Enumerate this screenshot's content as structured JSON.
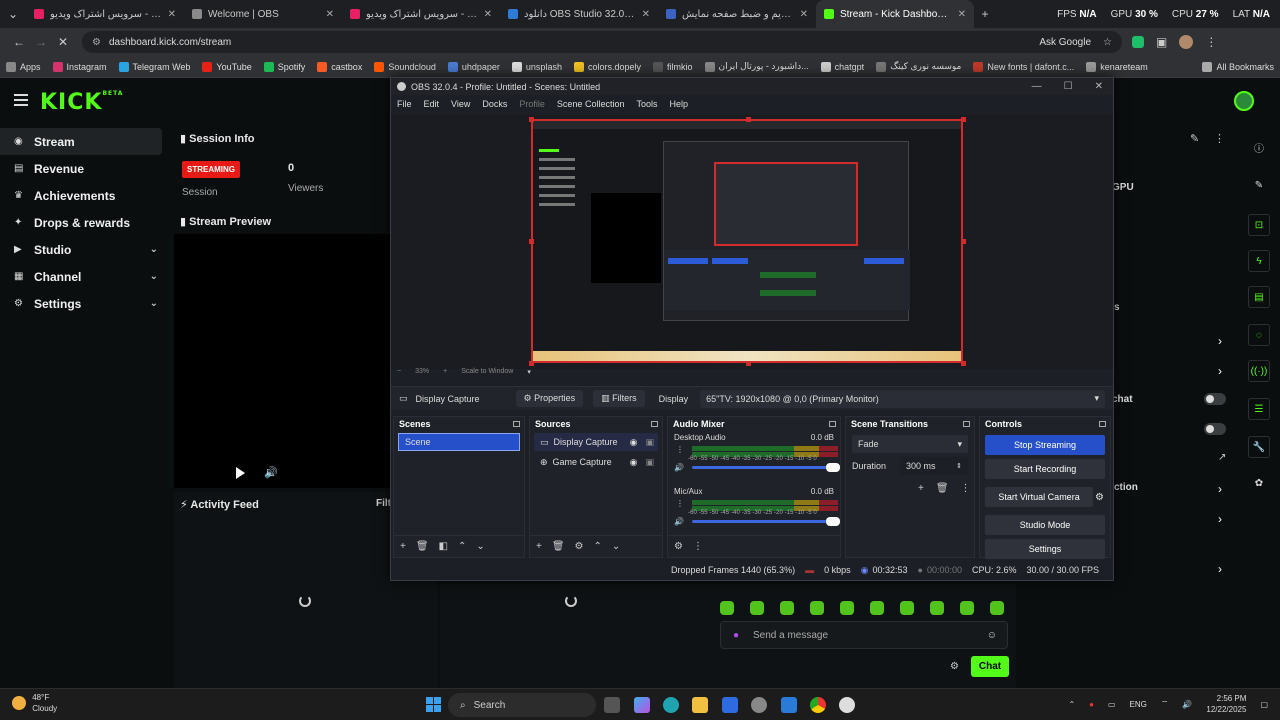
{
  "browser": {
    "tabs": [
      {
        "title": "آپارات - سرویس اشتراک ویدیو",
        "color": "#e91e63",
        "active": false
      },
      {
        "title": "Welcome | OBS",
        "color": "#8a8a8a",
        "active": false
      },
      {
        "title": "آپارات - سرویس اشتراک ویدیو",
        "color": "#e91e63",
        "active": false
      },
      {
        "title": "دانلود OBS Studio 32.0.4 Win/Mac",
        "color": "#2e7bd6",
        "active": false
      },
      {
        "title": "آموزش استریم و ضبط صفحه نمایش",
        "color": "#3b63c4",
        "active": false
      },
      {
        "title": "Stream - Kick Dashboard",
        "color": "#53fc18",
        "active": true
      }
    ],
    "new_tab": "+",
    "perf": {
      "fps_label": "FPS",
      "fps": "N/A",
      "gpu_label": "GPU",
      "gpu": "30 %",
      "cpu_label": "CPU",
      "cpu": "27 %",
      "lat_label": "LAT",
      "lat": "N/A"
    },
    "url": "dashboard.kick.com/stream",
    "ask_google": "Ask Google",
    "bookmarks": [
      {
        "label": "Apps",
        "color": "#888"
      },
      {
        "label": "Instagram",
        "color": "#d6336c"
      },
      {
        "label": "Telegram Web",
        "color": "#2aa3e3"
      },
      {
        "label": "YouTube",
        "color": "#e62117"
      },
      {
        "label": "Spotify",
        "color": "#1db954"
      },
      {
        "label": "castbox",
        "color": "#f55b23"
      },
      {
        "label": "Soundcloud",
        "color": "#ff5500"
      },
      {
        "label": "uhdpaper",
        "color": "#4a7bd0"
      },
      {
        "label": "unsplash",
        "color": "#ddd"
      },
      {
        "label": "colors.dopely",
        "color": "#f0c020"
      },
      {
        "label": "filmkio",
        "color": "#555"
      },
      {
        "label": "داشبورد - پورتال ایران...",
        "color": "#888"
      },
      {
        "label": "chatgpt",
        "color": "#ccc"
      },
      {
        "label": "موسسه نوری کینگ",
        "color": "#777"
      },
      {
        "label": "New fonts | dafont.c...",
        "color": "#c0392b"
      },
      {
        "label": "kenareteam",
        "color": "#999"
      }
    ],
    "all_bookmarks": "All Bookmarks"
  },
  "kick": {
    "logo": "KICK",
    "beta": "BETA",
    "nav": [
      {
        "label": "Stream",
        "icon": "radio-icon",
        "active": true,
        "chevron": false
      },
      {
        "label": "Revenue",
        "icon": "revenue-icon",
        "active": false,
        "chevron": false
      },
      {
        "label": "Achievements",
        "icon": "trophy-icon",
        "active": false,
        "chevron": false
      },
      {
        "label": "Drops & rewards",
        "icon": "gift-icon",
        "active": false,
        "chevron": false
      },
      {
        "label": "Studio",
        "icon": "studio-icon",
        "active": false,
        "chevron": true
      },
      {
        "label": "Channel",
        "icon": "channel-icon",
        "active": false,
        "chevron": true
      },
      {
        "label": "Settings",
        "icon": "gear-icon",
        "active": false,
        "chevron": true
      }
    ],
    "session_info": "Session Info",
    "status_badge": "STREAMING",
    "session_label": "Session",
    "viewers_count": "0",
    "viewers_label": "Viewers",
    "stream_preview": "Stream Preview",
    "activity_feed": "Activity Feed",
    "filter": "Filt",
    "right_labels": [
      "GPU",
      "s",
      "chat",
      "ction"
    ],
    "send_placeholder": "Send a message",
    "chat_button": "Chat",
    "accent": "#53fc18"
  },
  "obs": {
    "title": "OBS 32.0.4 - Profile: Untitled - Scenes: Untitled",
    "menu": [
      "File",
      "Edit",
      "View",
      "Docks",
      "Profile",
      "Scene Collection",
      "Tools",
      "Help"
    ],
    "zoom": "33%",
    "scale": "Scale to Window",
    "source_name": "Display Capture",
    "properties": "Properties",
    "filters": "Filters",
    "display_label": "Display",
    "display_value": "65\"TV: 1920x1080 @ 0,0 (Primary Monitor)",
    "docks": {
      "scenes": {
        "title": "Scenes",
        "items": [
          "Scene"
        ]
      },
      "sources": {
        "title": "Sources",
        "items": [
          "Display Capture",
          "Game Capture"
        ]
      },
      "mixer": {
        "title": "Audio Mixer",
        "channels": [
          {
            "name": "Desktop Audio",
            "db": "0.0 dB"
          },
          {
            "name": "Mic/Aux",
            "db": "0.0 dB"
          }
        ],
        "ticks": "-60 -55 -50 -45 -40 -35 -30 -25 -20 -15 -10 -5 0"
      },
      "transitions": {
        "title": "Scene Transitions",
        "type": "Fade",
        "duration_label": "Duration",
        "duration": "300 ms"
      },
      "controls": {
        "title": "Controls",
        "buttons": [
          "Stop Streaming",
          "Start Recording",
          "Start Virtual Camera",
          "Studio Mode",
          "Settings"
        ]
      }
    },
    "status": {
      "dropped": "Dropped Frames 1440 (65.3%)",
      "kbps": "0 kbps",
      "stream_time": "00:32:53",
      "rec_time": "00:00:00",
      "cpu": "CPU: 2.6%",
      "fps": "30.00 / 30.00 FPS"
    }
  },
  "taskbar": {
    "temp": "48°F",
    "weather": "Cloudy",
    "search": "Search",
    "lang": "ENG",
    "time": "2:56 PM",
    "date": "12/22/2025"
  }
}
